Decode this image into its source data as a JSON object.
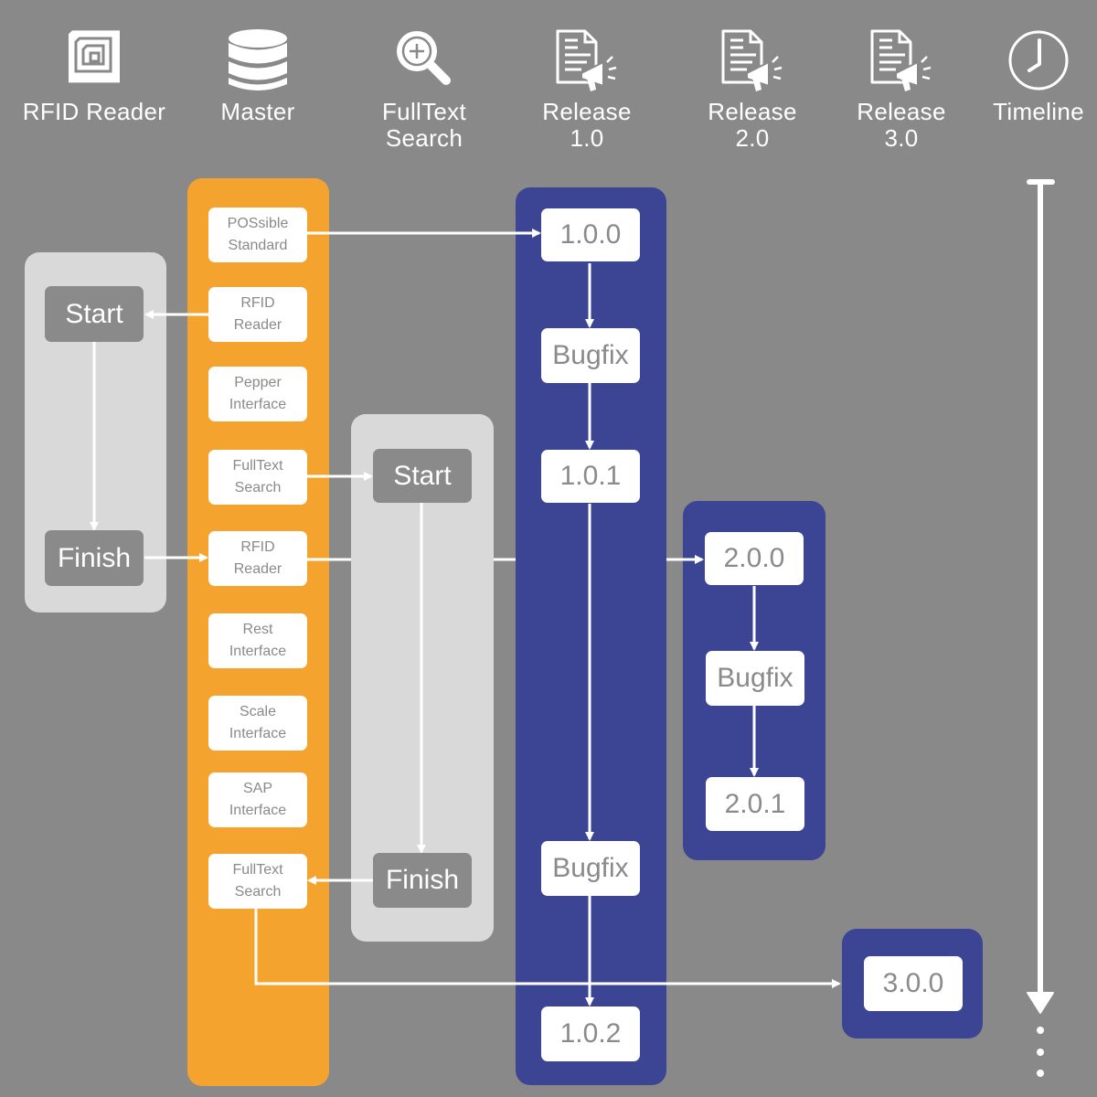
{
  "colors": {
    "background": "#898989",
    "master_column": "#f4a42e",
    "release_column": "#3c4494",
    "feature_panel": "#d9d9d9",
    "step_box": "#8a8a8a",
    "box": "#ffffff",
    "box_text": "#8a8a8a",
    "connector": "#ffffff"
  },
  "header": {
    "columns": [
      {
        "icon": "rfid-chip-icon",
        "label": "RFID Reader"
      },
      {
        "icon": "database-icon",
        "label": "Master"
      },
      {
        "icon": "search-plus-icon",
        "label": "FullText\nSearch"
      },
      {
        "icon": "release-notes-icon",
        "label": "Release\n1.0"
      },
      {
        "icon": "release-notes-icon",
        "label": "Release\n2.0"
      },
      {
        "icon": "release-notes-icon",
        "label": "Release\n3.0"
      },
      {
        "icon": "clock-icon",
        "label": "Timeline"
      }
    ]
  },
  "rfid_branch": {
    "start": "Start",
    "finish": "Finish"
  },
  "master": {
    "items": [
      {
        "line1": "POSsible",
        "line2": "Standard"
      },
      {
        "line1": "RFID",
        "line2": "Reader"
      },
      {
        "line1": "Pepper",
        "line2": "Interface"
      },
      {
        "line1": "FullText",
        "line2": "Search"
      },
      {
        "line1": "RFID",
        "line2": "Reader"
      },
      {
        "line1": "Rest",
        "line2": "Interface"
      },
      {
        "line1": "Scale",
        "line2": "Interface"
      },
      {
        "line1": "SAP",
        "line2": "Interface"
      },
      {
        "line1": "FullText",
        "line2": "Search"
      }
    ]
  },
  "fulltext_branch": {
    "start": "Start",
    "finish": "Finish"
  },
  "release1": {
    "nodes": [
      "1.0.0",
      "Bugfix",
      "1.0.1",
      "Bugfix",
      "1.0.2"
    ]
  },
  "release2": {
    "nodes": [
      "2.0.0",
      "Bugfix",
      "2.0.1"
    ]
  },
  "release3": {
    "nodes": [
      "3.0.0"
    ]
  },
  "timeline": {
    "continuation": "⋮"
  }
}
